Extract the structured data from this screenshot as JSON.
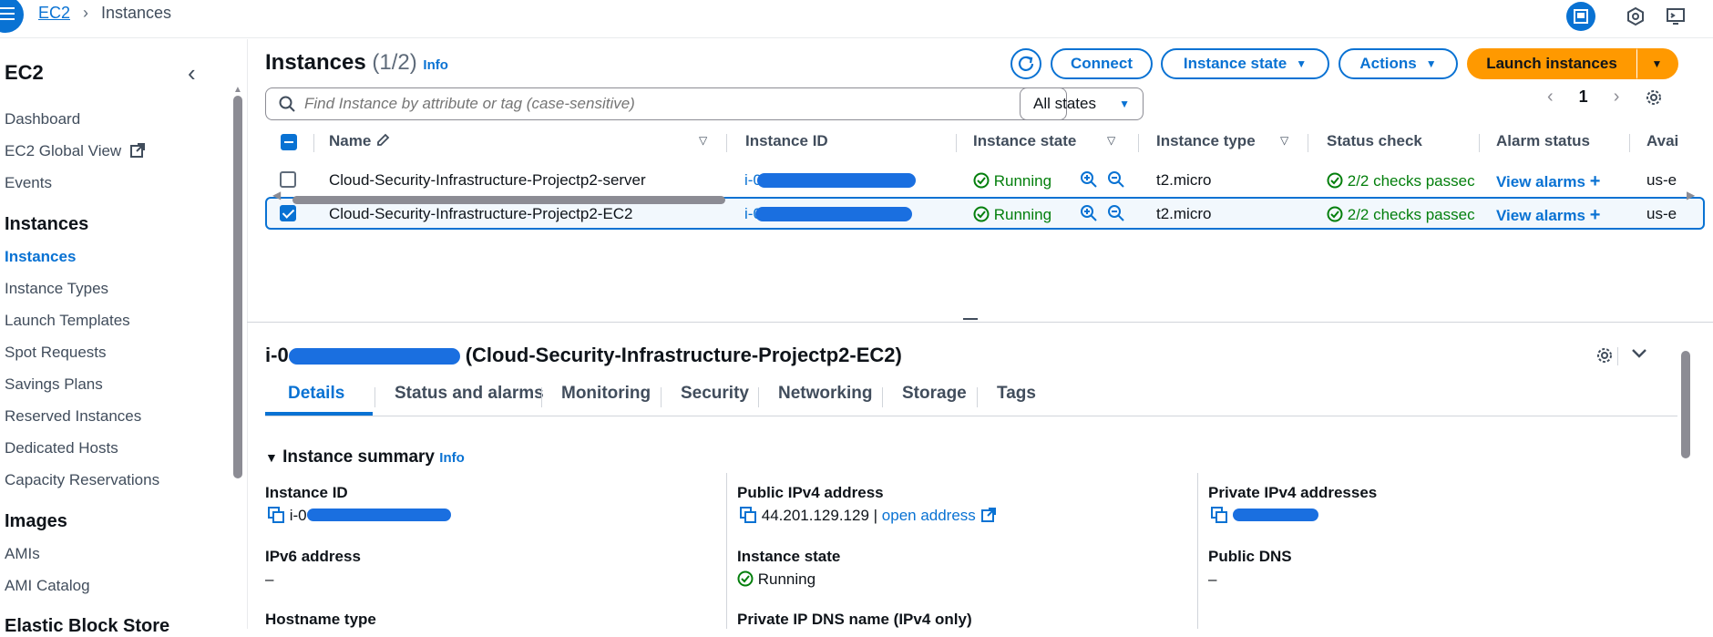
{
  "topbar": {
    "breadcrumb": [
      "EC2",
      "Instances"
    ]
  },
  "sidebar": {
    "title": "EC2",
    "items": [
      {
        "label": "Dashboard",
        "type": "item"
      },
      {
        "label": "EC2 Global View",
        "type": "item",
        "external": true
      },
      {
        "label": "Events",
        "type": "item"
      },
      {
        "label": "Instances",
        "type": "section"
      },
      {
        "label": "Instances",
        "type": "item",
        "active": true
      },
      {
        "label": "Instance Types",
        "type": "item"
      },
      {
        "label": "Launch Templates",
        "type": "item"
      },
      {
        "label": "Spot Requests",
        "type": "item"
      },
      {
        "label": "Savings Plans",
        "type": "item"
      },
      {
        "label": "Reserved Instances",
        "type": "item"
      },
      {
        "label": "Dedicated Hosts",
        "type": "item"
      },
      {
        "label": "Capacity Reservations",
        "type": "item"
      },
      {
        "label": "Images",
        "type": "section"
      },
      {
        "label": "AMIs",
        "type": "item"
      },
      {
        "label": "AMI Catalog",
        "type": "item"
      },
      {
        "label": "Elastic Block Store",
        "type": "section"
      }
    ]
  },
  "instances_panel": {
    "title": "Instances",
    "count": "(1/2)",
    "info": "Info",
    "connect_label": "Connect",
    "instance_state_label": "Instance state",
    "actions_label": "Actions",
    "launch_label": "Launch instances",
    "search_placeholder": "Find Instance by attribute or tag (case-sensitive)",
    "state_filter": "All states",
    "page": "1",
    "columns": [
      "Name",
      "Instance ID",
      "Instance state",
      "Instance type",
      "Status check",
      "Alarm status",
      "Avai"
    ],
    "rows": [
      {
        "name": "Cloud-Security-Infrastructure-Projectp2-server",
        "instance_id": "i-0",
        "state": "Running",
        "type": "t2.micro",
        "status_check": "2/2 checks passec",
        "alarm": "View alarms",
        "az": "us-e",
        "selected": false
      },
      {
        "name": "Cloud-Security-Infrastructure-Projectp2-EC2",
        "instance_id": "i-0",
        "state": "Running",
        "type": "t2.micro",
        "status_check": "2/2 checks passec",
        "alarm": "View alarms",
        "az": "us-e",
        "selected": true
      }
    ]
  },
  "details": {
    "title_prefix": "i-0",
    "title_suffix": "(Cloud-Security-Infrastructure-Projectp2-EC2)",
    "tabs": [
      "Details",
      "Status and alarms",
      "Monitoring",
      "Security",
      "Networking",
      "Storage",
      "Tags"
    ],
    "summary_title": "Instance summary",
    "info": "Info",
    "fields": {
      "instance_id_label": "Instance ID",
      "instance_id_value": "i-0",
      "public_ipv4_label": "Public IPv4 address",
      "public_ipv4_value": "44.201.129.129",
      "open_address": "open address",
      "private_ipv4_label": "Private IPv4 addresses",
      "ipv6_label": "IPv6 address",
      "ipv6_value": "–",
      "instance_state_label": "Instance state",
      "instance_state_value": "Running",
      "public_dns_label": "Public DNS",
      "public_dns_value": "–",
      "hostname_type_label": "Hostname type",
      "private_dns_label": "Private IP DNS name (IPv4 only)"
    }
  },
  "colors": {
    "accent": "#0972d3",
    "launch": "#ff9900",
    "success": "#037f0c",
    "redaction": "#1a6fe0"
  }
}
